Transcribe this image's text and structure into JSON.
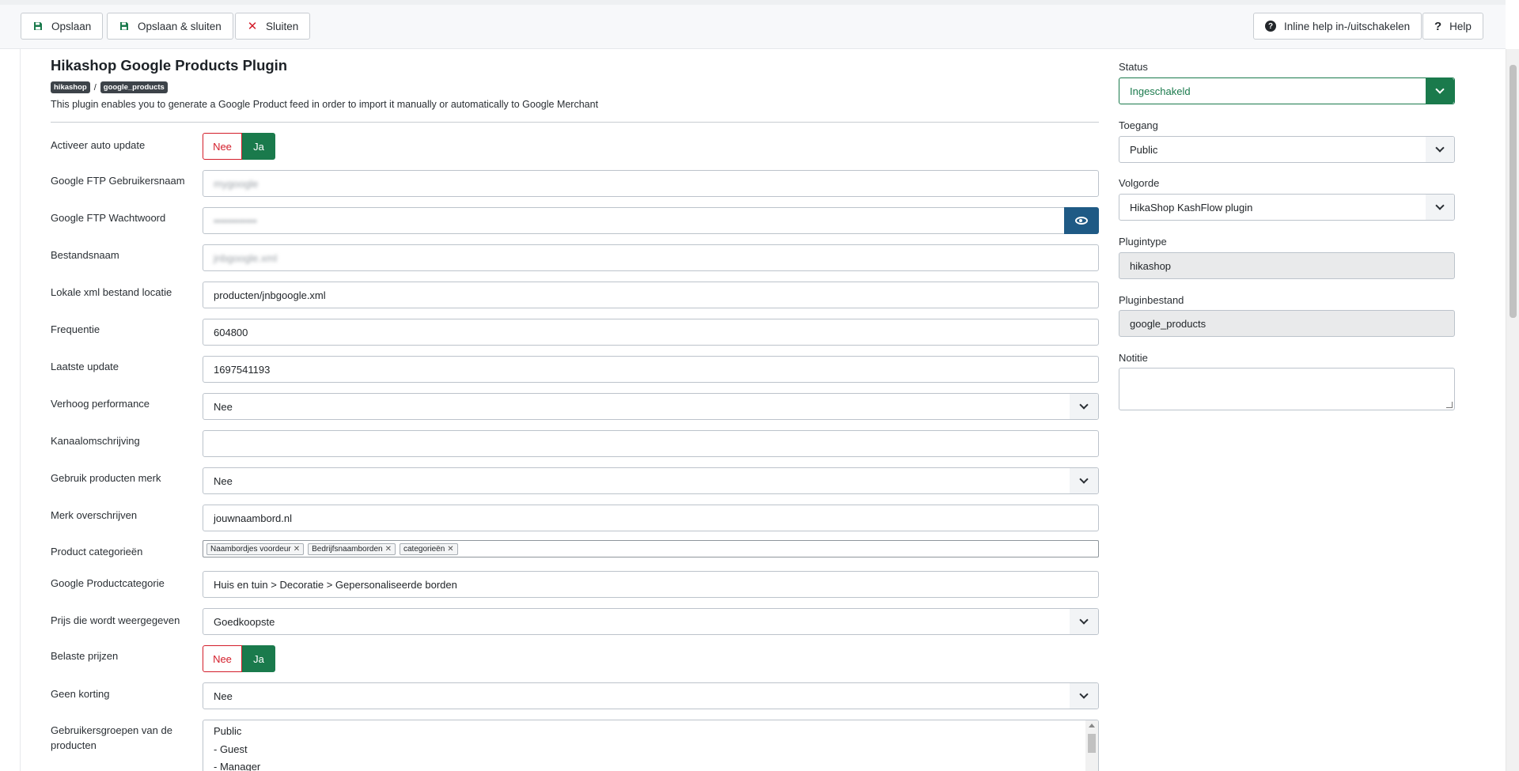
{
  "toolbar": {
    "save": "Opslaan",
    "save_close": "Opslaan & sluiten",
    "close": "Sluiten",
    "inline_help": "Inline help in-/uitschakelen",
    "help": "Help"
  },
  "header": {
    "title": "Hikashop Google Products Plugin",
    "tag1": "hikashop",
    "separator": "/",
    "tag2": "google_products",
    "description": "This plugin enables you to generate a Google Product feed in order to import it manually or automatically to Google Merchant"
  },
  "form": {
    "auto_update": {
      "label": "Activeer auto update",
      "no": "Nee",
      "yes": "Ja",
      "value": "Ja"
    },
    "ftp_user": {
      "label": "Google FTP Gebruikersnaam",
      "value": "mygoogle"
    },
    "ftp_pass": {
      "label": "Google FTP Wachtwoord",
      "value": "••••••••••••"
    },
    "filename": {
      "label": "Bestandsnaam",
      "value": "jnbgoogle.xml"
    },
    "local_xml": {
      "label": "Lokale xml bestand locatie",
      "value": "producten/jnbgoogle.xml"
    },
    "frequency": {
      "label": "Frequentie",
      "value": "604800"
    },
    "last_update": {
      "label": "Laatste update",
      "value": "1697541193"
    },
    "performance": {
      "label": "Verhoog performance",
      "value": "Nee"
    },
    "channel_desc": {
      "label": "Kanaalomschrijving",
      "value": ""
    },
    "use_brand": {
      "label": "Gebruik producten merk",
      "value": "Nee"
    },
    "brand_override": {
      "label": "Merk overschrijven",
      "value": "jouwnaambord.nl"
    },
    "categories": {
      "label": "Product categorieën",
      "chips": [
        "Naambordjes voordeur",
        "Bedrijfsnaamborden",
        "categorieën"
      ]
    },
    "google_category": {
      "label": "Google Productcategorie",
      "value": "Huis en tuin > Decoratie > Gepersonaliseerde borden"
    },
    "price_shown": {
      "label": "Prijs die wordt weergegeven",
      "value": "Goedkoopste"
    },
    "taxed_prices": {
      "label": "Belaste prijzen",
      "no": "Nee",
      "yes": "Ja",
      "value": "Ja"
    },
    "no_discount": {
      "label": "Geen korting",
      "value": "Nee"
    },
    "user_groups": {
      "label": "Gebruikersgroepen van de producten",
      "options": [
        "Public",
        "- Guest",
        "- Manager"
      ]
    }
  },
  "sidebar": {
    "status": {
      "label": "Status",
      "value": "Ingeschakeld"
    },
    "access": {
      "label": "Toegang",
      "value": "Public"
    },
    "order": {
      "label": "Volgorde",
      "value": "HikaShop KashFlow plugin"
    },
    "plugin_type": {
      "label": "Plugintype",
      "value": "hikashop"
    },
    "plugin_file": {
      "label": "Pluginbestand",
      "value": "google_products"
    },
    "note": {
      "label": "Notitie",
      "value": ""
    }
  },
  "colors": {
    "accent_green": "#1a7a4c",
    "danger_red": "#d31d2a",
    "eye_blue": "#1f5a85"
  }
}
